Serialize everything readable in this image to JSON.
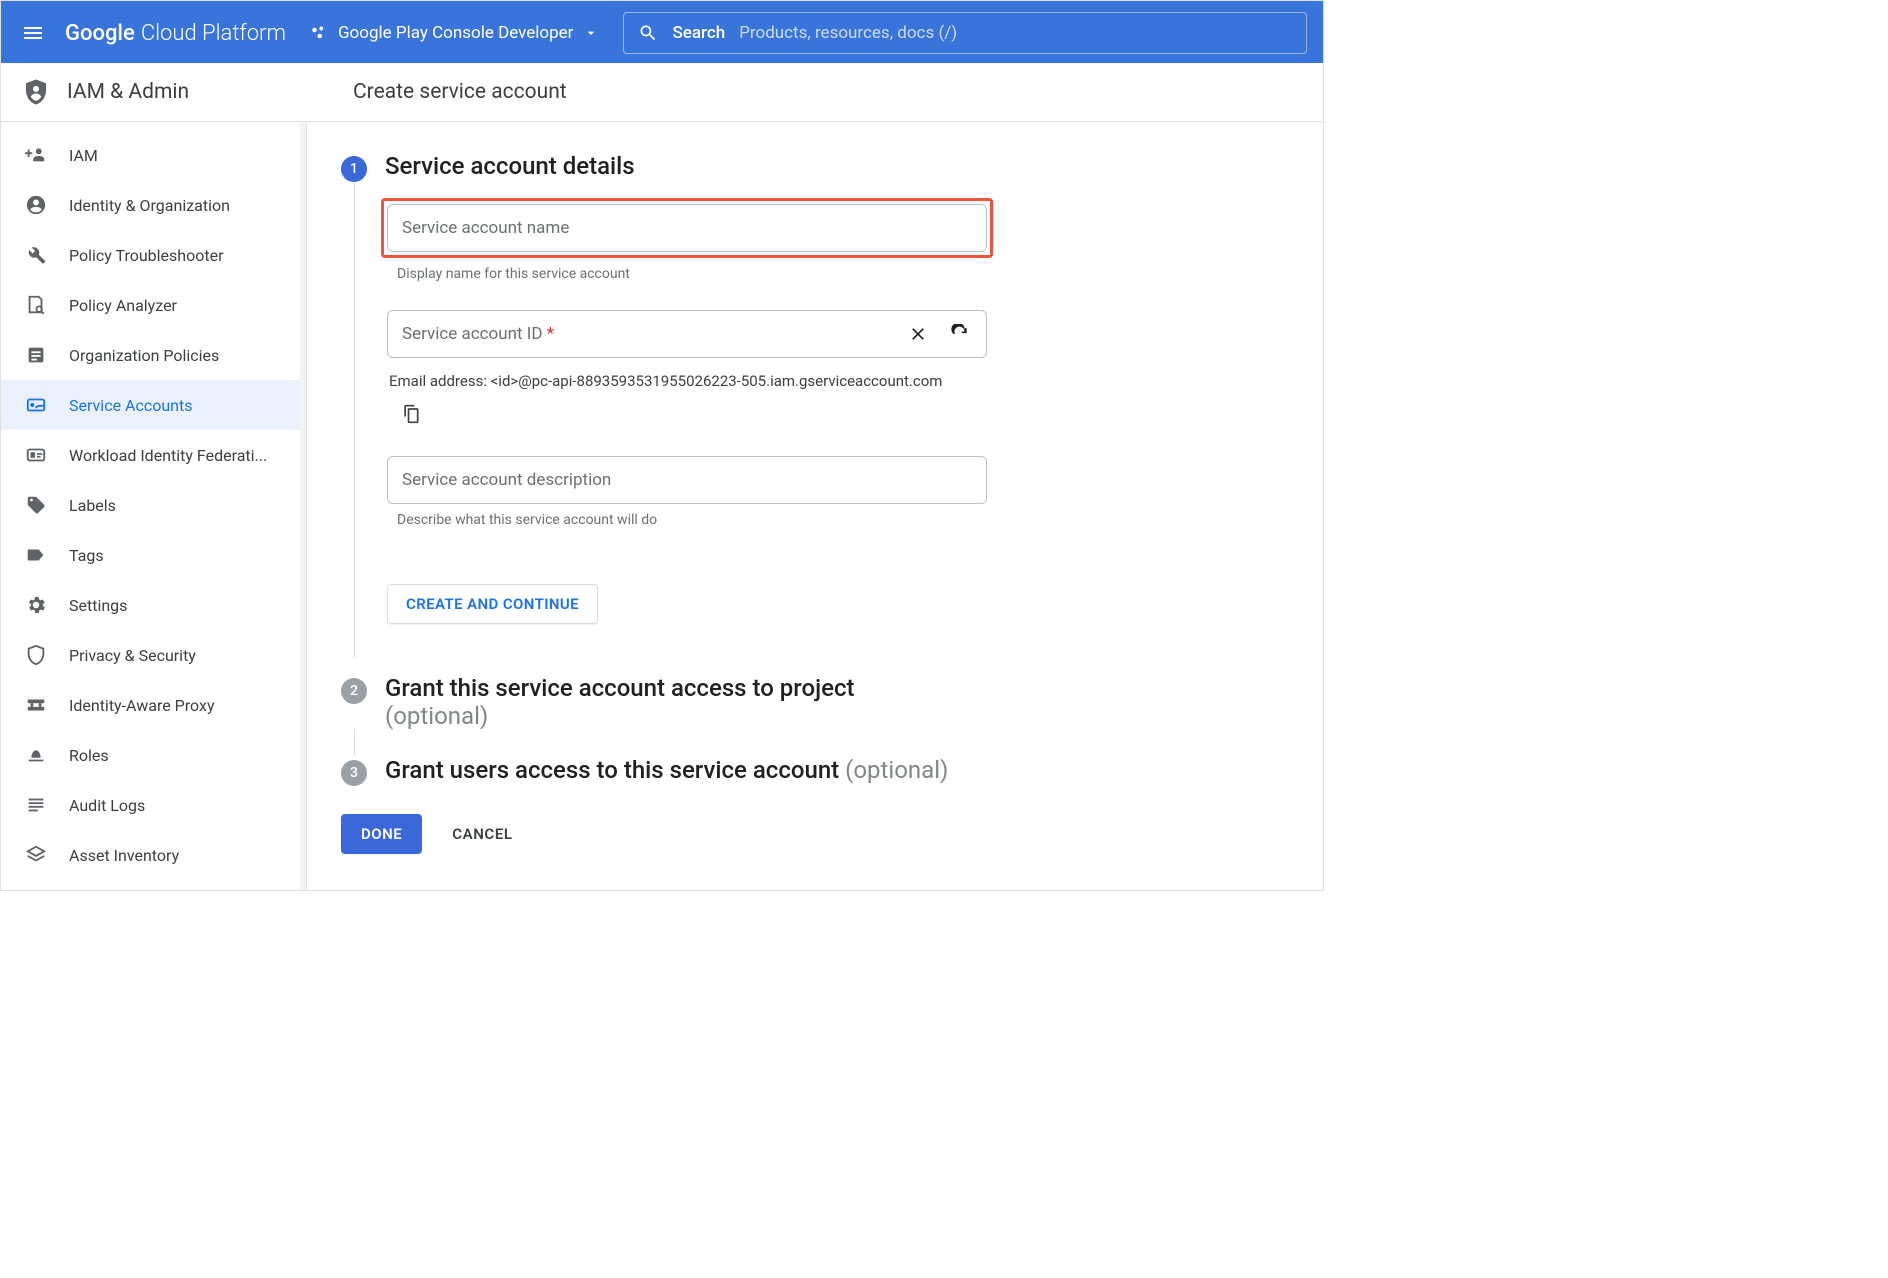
{
  "topbar": {
    "logo_google": "Google",
    "logo_cloud": "Cloud Platform",
    "project_name": "Google Play Console Developer",
    "search_label": "Search",
    "search_placeholder": "Products, resources, docs (/)"
  },
  "section": {
    "title": "IAM & Admin",
    "page_title": "Create service account"
  },
  "sidebar": {
    "items": [
      {
        "id": "iam",
        "label": "IAM"
      },
      {
        "id": "identity-org",
        "label": "Identity & Organization"
      },
      {
        "id": "policy-troubleshooter",
        "label": "Policy Troubleshooter"
      },
      {
        "id": "policy-analyzer",
        "label": "Policy Analyzer"
      },
      {
        "id": "org-policies",
        "label": "Organization Policies"
      },
      {
        "id": "service-accounts",
        "label": "Service Accounts",
        "active": true
      },
      {
        "id": "workload-identity",
        "label": "Workload Identity Federati..."
      },
      {
        "id": "labels",
        "label": "Labels"
      },
      {
        "id": "tags",
        "label": "Tags"
      },
      {
        "id": "settings",
        "label": "Settings"
      },
      {
        "id": "privacy-security",
        "label": "Privacy & Security"
      },
      {
        "id": "iap",
        "label": "Identity-Aware Proxy"
      },
      {
        "id": "roles",
        "label": "Roles"
      },
      {
        "id": "audit-logs",
        "label": "Audit Logs"
      },
      {
        "id": "asset-inventory",
        "label": "Asset Inventory"
      }
    ]
  },
  "steps": {
    "s1": {
      "num": "1",
      "title": "Service account details",
      "name_placeholder": "Service account name",
      "name_helper": "Display name for this service account",
      "id_placeholder": "Service account ID",
      "id_required_mark": "*",
      "email_helper": "Email address: <id>@pc-api-8893593531955026223-505.iam.gserviceaccount.com",
      "desc_placeholder": "Service account description",
      "desc_helper": "Describe what this service account will do",
      "create_btn": "CREATE AND CONTINUE"
    },
    "s2": {
      "num": "2",
      "title": "Grant this service account access to project",
      "optional": "(optional)"
    },
    "s3": {
      "num": "3",
      "title": "Grant users access to this service account ",
      "optional": "(optional)"
    }
  },
  "footer": {
    "done": "DONE",
    "cancel": "CANCEL"
  }
}
